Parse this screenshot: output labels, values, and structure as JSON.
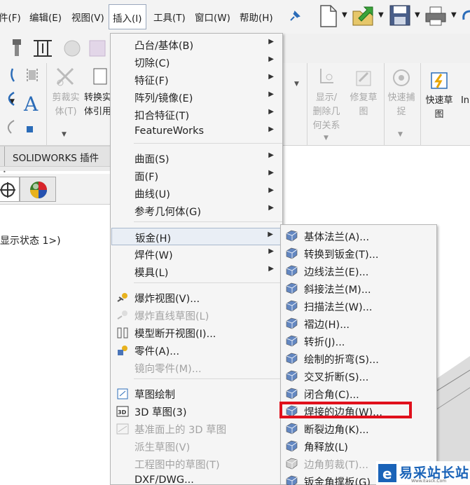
{
  "menubar": {
    "items": [
      "件(F)",
      "编辑(E)",
      "视图(V)",
      "插入(I)",
      "工具(T)",
      "窗口(W)",
      "帮助(H)"
    ],
    "pin_icon": "pin-icon"
  },
  "ribbon": {
    "cut_entity": "剪裁实\n体(T)",
    "convert_entity": "转换实\n体引用",
    "show_delete": "显示/\n删除几\n何关系",
    "repair_sketch": "修复草\n图",
    "quick_snap": "快速捕\n捉",
    "rapid_sketch": "快速草\n图",
    "cut_in": "In"
  },
  "tabstrip": {
    "label": "SOLIDWORKS 插件"
  },
  "left_pane": {
    "display_state": "显示状态 1>)"
  },
  "insert_menu": {
    "items": [
      {
        "label": "凸台/基体(B)",
        "submenu": true
      },
      {
        "label": "切除(C)",
        "submenu": true
      },
      {
        "label": "特征(F)",
        "submenu": true
      },
      {
        "label": "阵列/镜像(E)",
        "submenu": true
      },
      {
        "label": "扣合特征(T)",
        "submenu": true
      },
      {
        "label": "FeatureWorks",
        "submenu": true
      },
      {
        "label": "曲面(S)",
        "submenu": true
      },
      {
        "label": "面(F)",
        "submenu": true
      },
      {
        "label": "曲线(U)",
        "submenu": true
      },
      {
        "label": "参考几何体(G)",
        "submenu": true
      },
      {
        "label": "钣金(H)",
        "submenu": true
      },
      {
        "label": "焊件(W)",
        "submenu": true
      },
      {
        "label": "模具(L)",
        "submenu": true
      },
      {
        "label": "爆炸视图(V)...",
        "submenu": false
      },
      {
        "label": "爆炸直线草图(L)",
        "submenu": false
      },
      {
        "label": "模型断开视图(I)...",
        "submenu": false
      },
      {
        "label": "零件(A)...",
        "submenu": false
      },
      {
        "label": "镜向零件(M)...",
        "submenu": false
      },
      {
        "label": "草图绘制",
        "submenu": false
      },
      {
        "label": "3D 草图(3)",
        "submenu": false
      },
      {
        "label": "基准面上的 3D 草图",
        "submenu": false
      },
      {
        "label": "派生草图(V)",
        "submenu": false
      },
      {
        "label": "工程图中的草图(T)",
        "submenu": false
      },
      {
        "label": "DXF/DWG...",
        "submenu": false
      }
    ],
    "arrow_glyph": "▶"
  },
  "sheetmetal_menu": {
    "items": [
      {
        "label": "基体法兰(A)..."
      },
      {
        "label": "转换到钣金(T)..."
      },
      {
        "label": "边线法兰(E)..."
      },
      {
        "label": "斜接法兰(M)..."
      },
      {
        "label": "扫描法兰(W)..."
      },
      {
        "label": "褶边(H)..."
      },
      {
        "label": "转折(J)..."
      },
      {
        "label": "绘制的折弯(S)..."
      },
      {
        "label": "交叉折断(S)..."
      },
      {
        "label": "闭合角(C)..."
      },
      {
        "label": "焊接的边角(W)..."
      },
      {
        "label": "断裂边角(K)..."
      },
      {
        "label": "角释放(L)"
      },
      {
        "label": "边角剪裁(T)..."
      },
      {
        "label": "钣金角撑板(G)"
      }
    ]
  },
  "watermark": {
    "text": "易采站长站",
    "sub": "Www.Easck.Com"
  },
  "colors": {
    "highlight_box": "#e0101c",
    "accent_blue": "#2b6cb8"
  }
}
